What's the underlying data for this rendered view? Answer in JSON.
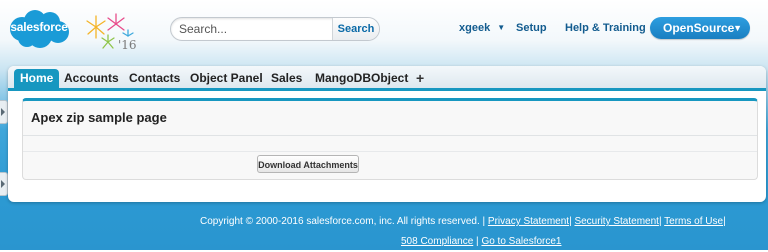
{
  "brand": {
    "logo_text": "salesforce",
    "release_badge": "'16",
    "colors": {
      "accent": "#1797c0",
      "brand": "#1a9bd7",
      "link": "#135c8f"
    }
  },
  "header": {
    "search": {
      "placeholder": "Search...",
      "button_label": "Search"
    },
    "user_menu_label": "xgeek",
    "links": [
      "Setup",
      "Help & Training"
    ],
    "app_switcher_label": "OpenSource"
  },
  "tabs": [
    {
      "label": "Home",
      "active": true
    },
    {
      "label": "Accounts"
    },
    {
      "label": "Contacts"
    },
    {
      "label": "Object Panel"
    },
    {
      "label": "Sales"
    },
    {
      "label": "MangoDBObject"
    },
    {
      "label": "+"
    }
  ],
  "page": {
    "title": "Apex zip sample page",
    "download_button_label": "Download Attachments"
  },
  "footer": {
    "copyright": "Copyright © 2000-2016 salesforce.com, inc. All rights reserved.",
    "links": [
      "Privacy Statement",
      "Security Statement",
      "Terms of Use",
      "508 Compliance",
      "Go to Salesforce1"
    ],
    "separator": "|"
  },
  "icons": [
    "salesforce-cloud-logo",
    "fireworks-release-badge",
    "caret-down-icon",
    "plus-icon",
    "expand-arrow-icon"
  ]
}
